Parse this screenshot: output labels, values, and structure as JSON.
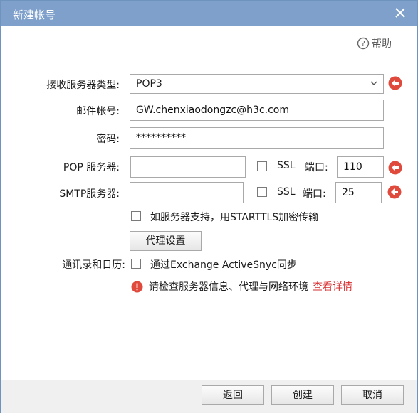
{
  "window": {
    "title": "新建帐号"
  },
  "help": {
    "label": "帮助"
  },
  "form": {
    "incoming_type": {
      "label": "接收服务器类型:",
      "value": "POP3"
    },
    "account": {
      "label": "邮件帐号:",
      "value": "GW.chenxiaodongzc@h3c.com"
    },
    "password": {
      "label": "密码:",
      "value": "**********"
    },
    "pop_server": {
      "label": "POP 服务器:",
      "value": "",
      "ssl_label": "SSL",
      "port_label": "端口:",
      "port": "110"
    },
    "smtp_server": {
      "label": "SMTP服务器:",
      "value": "",
      "ssl_label": "SSL",
      "port_label": "端口:",
      "port": "25"
    },
    "starttls": {
      "label": "如服务器支持，用STARTTLS加密传输"
    },
    "proxy_button": "代理设置",
    "contacts": {
      "label": "通讯录和日历:",
      "checkbox_label": "通过Exchange ActiveSnyc同步"
    },
    "error": {
      "message": "请检查服务器信息、代理与网络环境",
      "link": "查看详情",
      "color": "#d62c2c"
    }
  },
  "footer": {
    "back": "返回",
    "create": "创建",
    "cancel": "取消"
  },
  "colors": {
    "titlebar": "#7ea0cb",
    "accent_red": "#e04a3c"
  }
}
